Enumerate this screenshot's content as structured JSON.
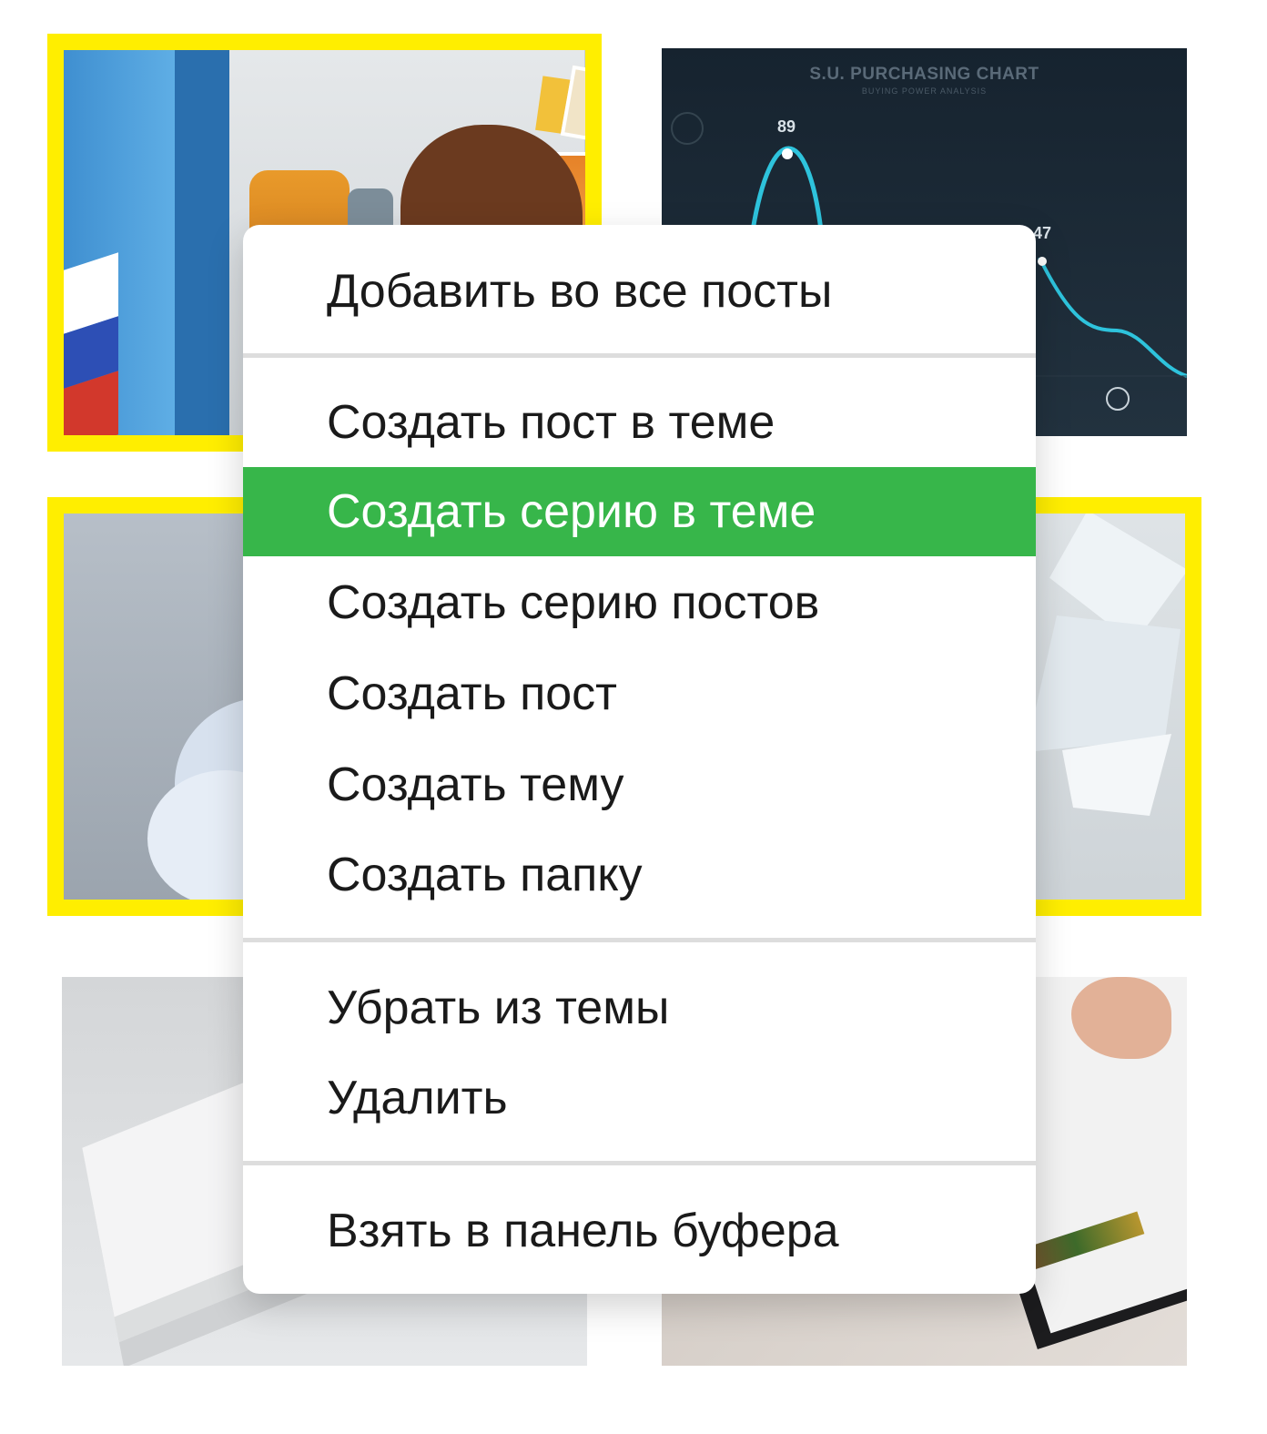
{
  "colors": {
    "highlight": "#37b64a",
    "selection_border": "#ffee00",
    "menu_text": "#1a1a1a"
  },
  "thumbnails": [
    {
      "id": "locker-illustration",
      "selected": true
    },
    {
      "id": "purchasing-chart",
      "selected": false,
      "title": "S.U. PURCHASING CHART",
      "subtitle": "BUYING POWER ANALYSIS",
      "value_labels": [
        "89",
        "47"
      ]
    },
    {
      "id": "cloud-render",
      "selected": true
    },
    {
      "id": "origami-paper",
      "selected": true
    },
    {
      "id": "business-cards",
      "selected": false
    },
    {
      "id": "tablet-hand",
      "selected": false
    }
  ],
  "context_menu": {
    "items": [
      {
        "label": "Добавить во все посты"
      },
      {
        "label": "Создать пост в теме"
      },
      {
        "label": "Создать серию в теме",
        "highlighted": true
      },
      {
        "label": "Создать серию постов"
      },
      {
        "label": "Создать пост"
      },
      {
        "label": "Создать тему"
      },
      {
        "label": "Создать папку"
      },
      {
        "label": "Убрать из темы"
      },
      {
        "label": "Удалить"
      },
      {
        "label": "Взять в панель буфера"
      }
    ]
  }
}
